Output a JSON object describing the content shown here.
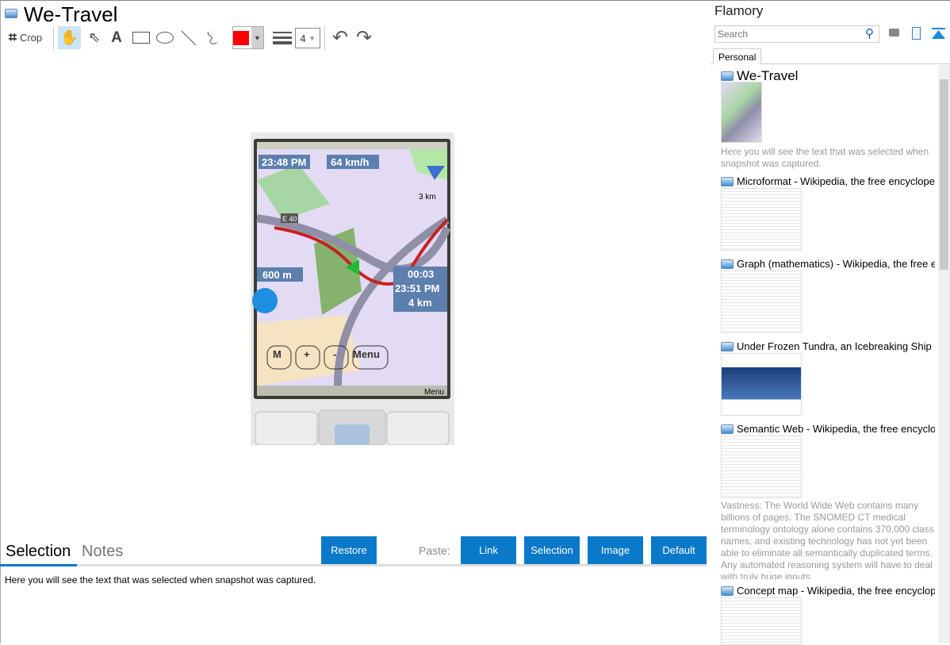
{
  "window": {
    "title": "We-Travel"
  },
  "toolbar": {
    "crop_label": "Crop",
    "stroke_width": "4",
    "color": "#ff0000"
  },
  "map": {
    "time": "23:48 PM",
    "speed": "64 km/h",
    "scale": "3 km",
    "road": "E 40",
    "distance": "600 m",
    "eta_duration": "00:03",
    "eta_time": "23:51 PM",
    "remaining": "4 km",
    "buttons": [
      "M",
      "+",
      "-",
      "Menu"
    ],
    "softkey": "Menu"
  },
  "bottom": {
    "tabs": [
      "Selection",
      "Notes"
    ],
    "restore": "Restore",
    "paste_label": "Paste:",
    "paste_buttons": [
      "Link",
      "Selection",
      "Image",
      "Default"
    ],
    "selection_text": "Here you will see the text that was selected when snapshot was captured."
  },
  "sidebar": {
    "title": "Flamory",
    "search_placeholder": "Search",
    "tab": "Personal",
    "items": [
      {
        "title": "We-Travel",
        "desc": "Here you will see the text that was selected when snapshot was captured."
      },
      {
        "title": "Microformat - Wikipedia, the free encyclopedia"
      },
      {
        "title": "Graph (mathematics) - Wikipedia, the free encyclopedia"
      },
      {
        "title": "Under Frozen Tundra, an Icebreaking Ship Uncovers"
      },
      {
        "title": "Semantic Web - Wikipedia, the free encyclopedia",
        "desc": "Vastness: The World Wide Web contains many billions of pages. The SNOMED CT medical terminology ontology alone contains 370,000 class names, and existing technology has not yet been able to eliminate all semantically duplicated terms. Any automated reasoning system will have to deal with truly huge inputs."
      },
      {
        "title": "Concept map - Wikipedia, the free encyclopedia"
      }
    ]
  }
}
